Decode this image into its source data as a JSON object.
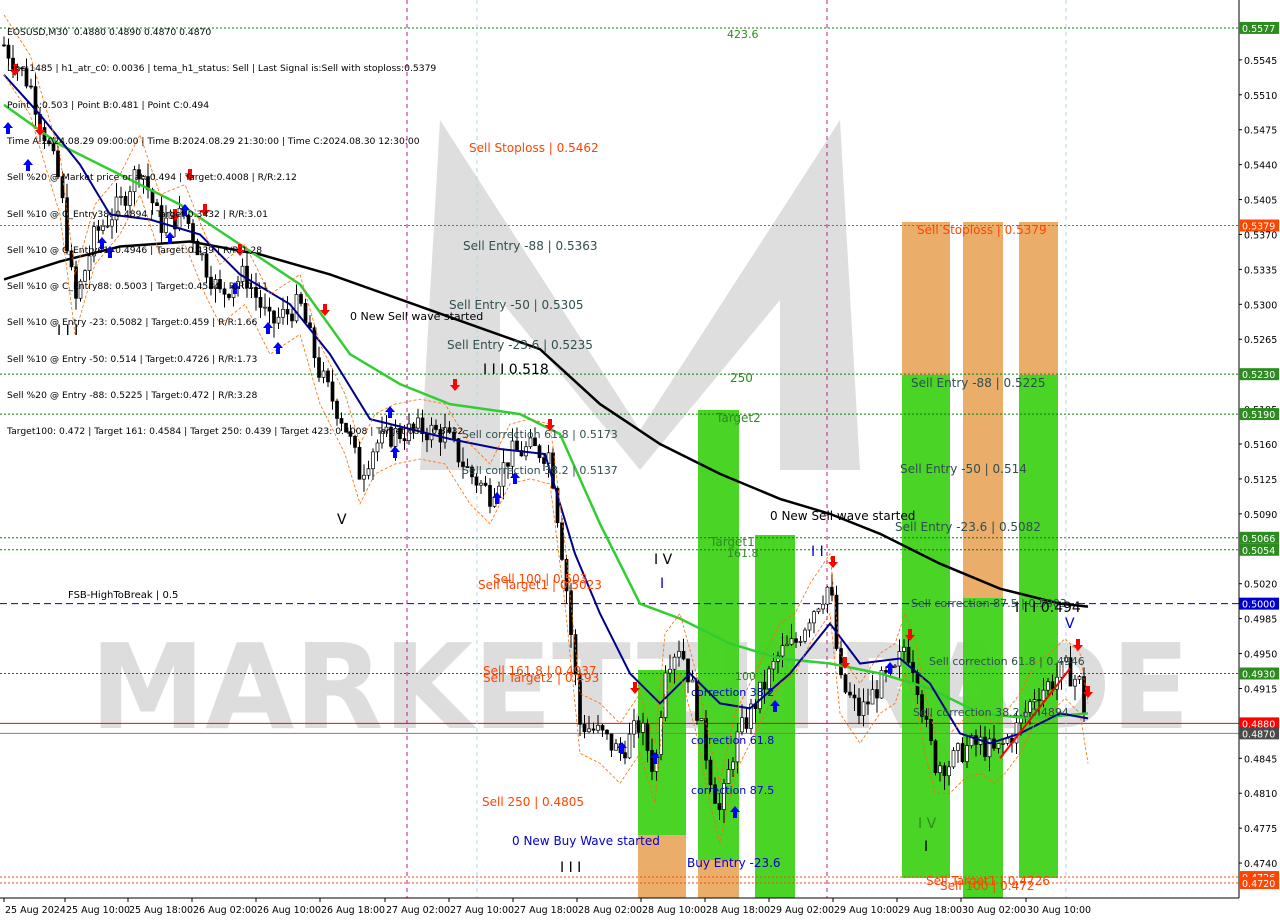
{
  "header": {
    "lines": [
      "EOSUSD,M30  0.4880 0.4890 0.4870 0.4870",
      "Line:1485 | h1_atr_c0: 0.0036 | tema_h1_status: Sell | Last Signal is:Sell with stoploss:0.5379",
      "Point A:0.503 | Point B:0.481 | Point C:0.494",
      "Time A:2024.08.29 09:00:00 | Time B:2024.08.29 21:30:00 | Time C:2024.08.30 12:30:00",
      "Sell %20 @ Market price or at: 0.494 | Target:0.4008 | R/R:2.12",
      "Sell %10 @ C_Entry38: 0.4894 | Target:0.3432 | R/R:3.01",
      "Sell %10 @ C_Entry61: 0.4946 | Target:0.439 | R/R:1.28",
      "Sell %10 @ C_Entry88: 0.5003 | Target:0.4584 | R/R:1.11",
      "Sell %10 @ Entry -23: 0.5082 | Target:0.459 | R/R:1.66",
      "Sell %10 @ Entry -50: 0.514 | Target:0.4726 | R/R:1.73",
      "Sell %20 @ Entry -88: 0.5225 | Target:0.472 | R/R:3.28",
      "Target100: 0.472 | Target 161: 0.4584 | Target 250: 0.439 | Target 423: 0.4008 | Target 685: 0.3432"
    ]
  },
  "watermark": "MARKETZITRADE",
  "colors": {
    "bull": "#000000",
    "bear": "#000000",
    "ema_fast": "#00008b",
    "ema_mid": "#32cd32",
    "ema_slow": "#000000",
    "green_zone": "#3fd21a",
    "orange_zone": "#e8a050",
    "stop": "#ff4500",
    "level": "#008000",
    "hbreak": "#0000cd",
    "price_line": "#ff0000",
    "vline": "#c71585"
  },
  "chart_data": {
    "type": "candlestick",
    "symbol": "EOSUSD",
    "timeframe": "M30",
    "ylim": [
      0.4705,
      0.5605
    ],
    "yticks": [
      "0.5545",
      "0.5510",
      "0.5475",
      "0.5440",
      "0.5405",
      "0.5370",
      "0.5335",
      "0.5300",
      "0.5265",
      "0.5230",
      "0.5195",
      "0.5160",
      "0.5125",
      "0.5090",
      "0.5055",
      "0.5020",
      "0.4985",
      "0.4950",
      "0.4915",
      "0.4880",
      "0.4845",
      "0.4810",
      "0.4775",
      "0.4740"
    ],
    "xticks": [
      "25 Aug 2024",
      "25 Aug 10:00",
      "25 Aug 18:00",
      "26 Aug 02:00",
      "26 Aug 10:00",
      "26 Aug 18:00",
      "27 Aug 02:00",
      "27 Aug 10:00",
      "27 Aug 18:00",
      "28 Aug 02:00",
      "28 Aug 10:00",
      "28 Aug 18:00",
      "29 Aug 02:00",
      "29 Aug 10:00",
      "29 Aug 18:00",
      "30 Aug 02:00",
      "30 Aug 10:00"
    ],
    "current_price": "0.4870",
    "price_labels": [
      {
        "text": "0.5577",
        "value": 0.5577,
        "color": "#2e8b22"
      },
      {
        "text": "0.5379",
        "value": 0.5379,
        "color": "#ff4500"
      },
      {
        "text": "0.5230",
        "value": 0.523,
        "color": "#2e8b22"
      },
      {
        "text": "0.5190",
        "value": 0.519,
        "color": "#2e8b22"
      },
      {
        "text": "0.5066",
        "value": 0.5066,
        "color": "#2e8b22"
      },
      {
        "text": "0.5054",
        "value": 0.5054,
        "color": "#2e8b22"
      },
      {
        "text": "0.5000",
        "value": 0.5,
        "color": "#0000cd"
      },
      {
        "text": "0.4930",
        "value": 0.493,
        "color": "#2e8b22"
      },
      {
        "text": "0.4880",
        "value": 0.488,
        "color": "#ff0000"
      },
      {
        "text": "0.4870",
        "value": 0.487,
        "color": "#4a4a4a"
      },
      {
        "text": "0.4726",
        "value": 0.4726,
        "color": "#ff4500"
      },
      {
        "text": "0.4720",
        "value": 0.472,
        "color": "#ff4500"
      }
    ],
    "levels": [
      {
        "value": 0.5577,
        "color": "#008000",
        "style": "dotted"
      },
      {
        "value": 0.5379,
        "color": "#ff4500",
        "style": "dotted"
      },
      {
        "value": 0.523,
        "color": "#008000",
        "style": "dotted"
      },
      {
        "value": 0.519,
        "color": "#008000",
        "style": "dotted"
      },
      {
        "value": 0.5066,
        "color": "#008000",
        "style": "dotted"
      },
      {
        "value": 0.5054,
        "color": "#008000",
        "style": "dotted"
      },
      {
        "value": 0.5,
        "color": "#0000cd",
        "style": "dashed"
      },
      {
        "value": 0.493,
        "color": "#008000",
        "style": "dotted"
      },
      {
        "value": 0.488,
        "color": "#ff0000",
        "style": "solid"
      },
      {
        "value": 0.487,
        "color": "#808080",
        "style": "solid"
      },
      {
        "value": 0.4726,
        "color": "#ff4500",
        "style": "dotted"
      },
      {
        "value": 0.472,
        "color": "#ff4500",
        "style": "dotted"
      }
    ],
    "annotations": [
      {
        "text": "423.6",
        "color": "#2e8b22"
      },
      {
        "text": "Sell Stoploss | 0.5462",
        "color": "#ff4500"
      },
      {
        "text": "Sell Entry -88 | 0.5363",
        "color": "#2f4f4f"
      },
      {
        "text": "Sell Entry -50 | 0.5305",
        "color": "#2f4f4f"
      },
      {
        "text": "0 New Sell wave started",
        "color": "#000000"
      },
      {
        "text": "Sell Entry -23.6 | 0.5235",
        "color": "#2f4f4f"
      },
      {
        "text": "I I I 0.518",
        "color": "#000000"
      },
      {
        "text": "250",
        "color": "#2e8b22"
      },
      {
        "text": "Target2",
        "color": "#2e8b22"
      },
      {
        "text": "Sell correction 61.8 | 0.5173",
        "color": "#2f4f4f"
      },
      {
        "text": "Sell correction 38.2 | 0.5137",
        "color": "#2f4f4f"
      },
      {
        "text": "V",
        "color": "#000000"
      },
      {
        "text": "I I I",
        "color": "#000000"
      },
      {
        "text": "I V",
        "color": "#000000"
      },
      {
        "text": "I",
        "color": "#0000cd"
      },
      {
        "text": "Sell 100 | 0.503",
        "color": "#ff4500"
      },
      {
        "text": "Sell Target1 | 0.5023",
        "color": "#ff4500"
      },
      {
        "text": "FSB-HighToBreak | 0.5",
        "color": "#000000"
      },
      {
        "text": "Sell 161.8 | 0.4937",
        "color": "#ff4500"
      },
      {
        "text": "Sell Target2 | 0.493",
        "color": "#ff4500"
      },
      {
        "text": "Sell  250 | 0.4805",
        "color": "#ff4500"
      },
      {
        "text": "0 New Buy Wave started",
        "color": "#0000cd"
      },
      {
        "text": "I I I",
        "color": "#000000"
      },
      {
        "text": "Target1",
        "color": "#2e8b22"
      },
      {
        "text": "161.8",
        "color": "#2e8b22"
      },
      {
        "text": "100",
        "color": "#2e8b22"
      },
      {
        "text": "correction 38.2",
        "color": "#0000cd"
      },
      {
        "text": "correction 61.8",
        "color": "#0000cd"
      },
      {
        "text": "correction 87.5",
        "color": "#0000cd"
      },
      {
        "text": "Buy Entry -23.6",
        "color": "#0000cd"
      },
      {
        "text": "I I",
        "color": "#0000cd"
      },
      {
        "text": "0 New Sell wave started",
        "color": "#000000"
      },
      {
        "text": "Sell Stoploss | 0.5379",
        "color": "#ff4500"
      },
      {
        "text": "Sell Entry -88 | 0.5225",
        "color": "#2f4f4f"
      },
      {
        "text": "Sell Entry -50 | 0.514",
        "color": "#2f4f4f"
      },
      {
        "text": "Sell Entry -23.6 | 0.5082",
        "color": "#2f4f4f"
      },
      {
        "text": "Sell correction 87.5 | 0.5003",
        "color": "#2f4f4f"
      },
      {
        "text": "I I I 0.494",
        "color": "#000000"
      },
      {
        "text": "V",
        "color": "#0000cd"
      },
      {
        "text": "Sell correction 61.8 | 0.4946",
        "color": "#2f4f4f"
      },
      {
        "text": "Sell correction 38.2 | 0.4894",
        "color": "#2f4f4f"
      },
      {
        "text": "I V",
        "color": "#2e8b22"
      },
      {
        "text": "I",
        "color": "#000000"
      },
      {
        "text": "Sell Target1 | 0.4726",
        "color": "#ff4500"
      },
      {
        "text": "Sell 100 | 0.472",
        "color": "#ff4500"
      }
    ]
  }
}
